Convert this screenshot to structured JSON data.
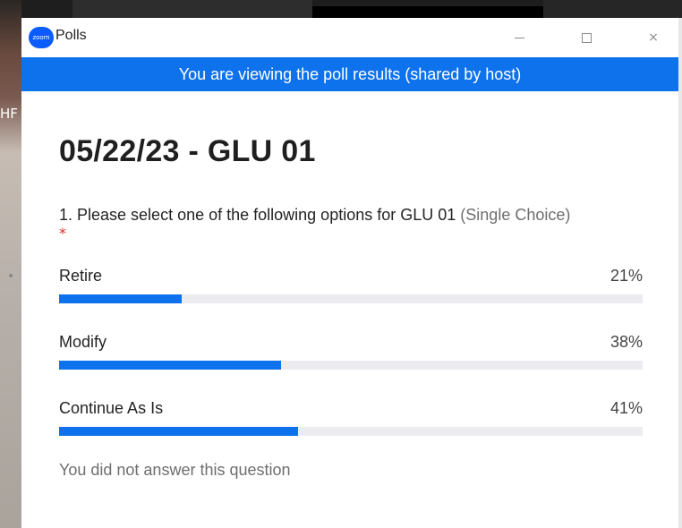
{
  "background": {
    "edge_text": "HF"
  },
  "window": {
    "app_logo_text": "zoom",
    "title": "Polls",
    "controls": [
      "minimize-icon",
      "maximize-icon",
      "close-icon"
    ],
    "close_glyph": "×"
  },
  "banner": {
    "text": "You are viewing the poll results (shared by host)",
    "color": "#0e72ed"
  },
  "poll": {
    "title": "05/22/23 - GLU 01",
    "question": {
      "text": "1. Please select one of the following options for GLU 01",
      "type": "(Single Choice)",
      "required_mark": "*"
    },
    "options": [
      {
        "label": "Retire",
        "percent_label": "21%",
        "percent": 21
      },
      {
        "label": "Modify",
        "percent_label": "38%",
        "percent": 38
      },
      {
        "label": "Continue As Is",
        "percent_label": "41%",
        "percent": 41
      }
    ],
    "footer_note": "You did not answer this question"
  },
  "colors": {
    "accent": "#0e72ed",
    "required": "#e02828",
    "bar_track": "#ececf0"
  }
}
